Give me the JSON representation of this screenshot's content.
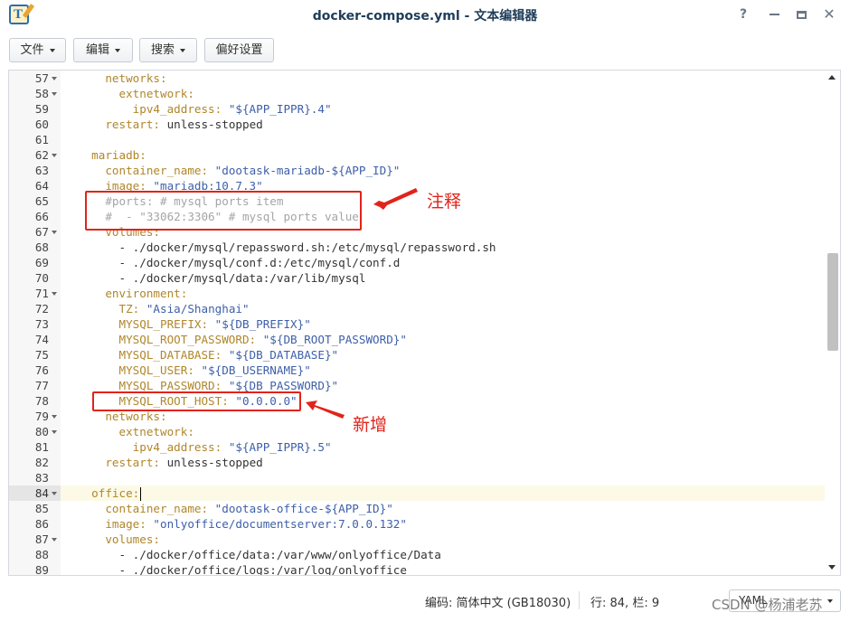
{
  "window": {
    "title": "docker-compose.yml - 文本编辑器",
    "help_icon": "?",
    "close_icon": "✕"
  },
  "toolbar": {
    "file": "文件",
    "edit": "编辑",
    "search": "搜索",
    "preferences": "偏好设置"
  },
  "editor": {
    "current_line": "84",
    "lines": [
      {
        "n": "57",
        "fold": true,
        "segs": [
          [
            "k",
            "    networks:"
          ]
        ]
      },
      {
        "n": "58",
        "fold": true,
        "segs": [
          [
            "k",
            "      extnetwork:"
          ]
        ]
      },
      {
        "n": "59",
        "fold": false,
        "segs": [
          [
            "k",
            "        ipv4_address: "
          ],
          [
            "s",
            "\"${APP_IPPR}.4\""
          ]
        ]
      },
      {
        "n": "60",
        "fold": false,
        "segs": [
          [
            "k",
            "    restart: "
          ],
          [
            "p",
            "unless-stopped"
          ]
        ]
      },
      {
        "n": "61",
        "fold": false,
        "segs": []
      },
      {
        "n": "62",
        "fold": true,
        "segs": [
          [
            "k",
            "  mariadb:"
          ]
        ]
      },
      {
        "n": "63",
        "fold": false,
        "segs": [
          [
            "k",
            "    container_name: "
          ],
          [
            "s",
            "\"dootask-mariadb-${APP_ID}\""
          ]
        ]
      },
      {
        "n": "64",
        "fold": false,
        "segs": [
          [
            "k",
            "    image: "
          ],
          [
            "s",
            "\"mariadb:10.7.3\""
          ]
        ]
      },
      {
        "n": "65",
        "fold": false,
        "segs": [
          [
            "c",
            "    #ports: # mysql ports item"
          ]
        ]
      },
      {
        "n": "66",
        "fold": false,
        "segs": [
          [
            "c",
            "    #  - \"33062:3306\" # mysql ports value"
          ]
        ]
      },
      {
        "n": "67",
        "fold": true,
        "segs": [
          [
            "k",
            "    volumes:"
          ]
        ]
      },
      {
        "n": "68",
        "fold": false,
        "segs": [
          [
            "p",
            "      - ./docker/mysql/repassword.sh:/etc/mysql/repassword.sh"
          ]
        ]
      },
      {
        "n": "69",
        "fold": false,
        "segs": [
          [
            "p",
            "      - ./docker/mysql/conf.d:/etc/mysql/conf.d"
          ]
        ]
      },
      {
        "n": "70",
        "fold": false,
        "segs": [
          [
            "p",
            "      - ./docker/mysql/data:/var/lib/mysql"
          ]
        ]
      },
      {
        "n": "71",
        "fold": true,
        "segs": [
          [
            "k",
            "    environment:"
          ]
        ]
      },
      {
        "n": "72",
        "fold": false,
        "segs": [
          [
            "k",
            "      TZ: "
          ],
          [
            "s",
            "\"Asia/Shanghai\""
          ]
        ]
      },
      {
        "n": "73",
        "fold": false,
        "segs": [
          [
            "k",
            "      MYSQL_PREFIX: "
          ],
          [
            "s",
            "\"${DB_PREFIX}\""
          ]
        ]
      },
      {
        "n": "74",
        "fold": false,
        "segs": [
          [
            "k",
            "      MYSQL_ROOT_PASSWORD: "
          ],
          [
            "s",
            "\"${DB_ROOT_PASSWORD}\""
          ]
        ]
      },
      {
        "n": "75",
        "fold": false,
        "segs": [
          [
            "k",
            "      MYSQL_DATABASE: "
          ],
          [
            "s",
            "\"${DB_DATABASE}\""
          ]
        ]
      },
      {
        "n": "76",
        "fold": false,
        "segs": [
          [
            "k",
            "      MYSQL_USER: "
          ],
          [
            "s",
            "\"${DB_USERNAME}\""
          ]
        ]
      },
      {
        "n": "77",
        "fold": false,
        "segs": [
          [
            "k",
            "      MYSQL_PASSWORD: "
          ],
          [
            "s",
            "\"${DB_PASSWORD}\""
          ]
        ]
      },
      {
        "n": "78",
        "fold": false,
        "segs": [
          [
            "k",
            "      MYSQL_ROOT_HOST: "
          ],
          [
            "s",
            "\"0.0.0.0\""
          ]
        ]
      },
      {
        "n": "79",
        "fold": true,
        "segs": [
          [
            "k",
            "    networks:"
          ]
        ]
      },
      {
        "n": "80",
        "fold": true,
        "segs": [
          [
            "k",
            "      extnetwork:"
          ]
        ]
      },
      {
        "n": "81",
        "fold": false,
        "segs": [
          [
            "k",
            "        ipv4_address: "
          ],
          [
            "s",
            "\"${APP_IPPR}.5\""
          ]
        ]
      },
      {
        "n": "82",
        "fold": false,
        "segs": [
          [
            "k",
            "    restart: "
          ],
          [
            "p",
            "unless-stopped"
          ]
        ]
      },
      {
        "n": "83",
        "fold": false,
        "segs": []
      },
      {
        "n": "84",
        "fold": true,
        "segs": [
          [
            "k",
            "  office:"
          ]
        ]
      },
      {
        "n": "85",
        "fold": false,
        "segs": [
          [
            "k",
            "    container_name: "
          ],
          [
            "s",
            "\"dootask-office-${APP_ID}\""
          ]
        ]
      },
      {
        "n": "86",
        "fold": false,
        "segs": [
          [
            "k",
            "    image: "
          ],
          [
            "s",
            "\"onlyoffice/documentserver:7.0.0.132\""
          ]
        ]
      },
      {
        "n": "87",
        "fold": true,
        "segs": [
          [
            "k",
            "    volumes:"
          ]
        ]
      },
      {
        "n": "88",
        "fold": false,
        "segs": [
          [
            "p",
            "      - ./docker/office/data:/var/www/onlyoffice/Data"
          ]
        ]
      },
      {
        "n": "89",
        "fold": false,
        "segs": [
          [
            "p",
            "      - ./docker/office/logs:/var/log/onlyoffice"
          ]
        ]
      }
    ]
  },
  "annotations": {
    "comment_label": "注释",
    "new_label": "新增",
    "color": "#e2231a"
  },
  "status": {
    "encoding": "编码: 简体中文 (GB18030)",
    "position": "行: 84, 栏: 9",
    "language": "YAML"
  },
  "watermark": "CSDN @杨浦老苏"
}
